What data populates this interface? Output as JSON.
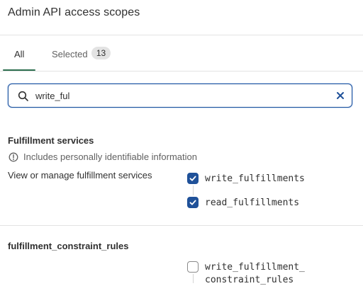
{
  "header": {
    "title": "Admin API access scopes"
  },
  "tabs": {
    "all_label": "All",
    "selected_label": "Selected",
    "selected_count": "13"
  },
  "search": {
    "value": "write_ful"
  },
  "sections": [
    {
      "title": "Fulfillment services",
      "info": "Includes personally identifiable information",
      "description": "View or manage fulfillment services",
      "scopes": [
        {
          "label": "write_fulfillments",
          "checked": true
        },
        {
          "label": "read_fulfillments",
          "checked": true
        }
      ]
    },
    {
      "title": "fulfillment_constraint_rules",
      "scopes": [
        {
          "label_line1": "write_fulfillment_",
          "label_line2": "constraint_rules",
          "checked": false
        }
      ]
    }
  ],
  "colors": {
    "accent": "#1f5199",
    "tab_underline": "#2c6e4e"
  },
  "icons": {
    "search": "search-icon",
    "clear": "close-icon",
    "info": "info-icon",
    "check": "checkmark-icon"
  }
}
